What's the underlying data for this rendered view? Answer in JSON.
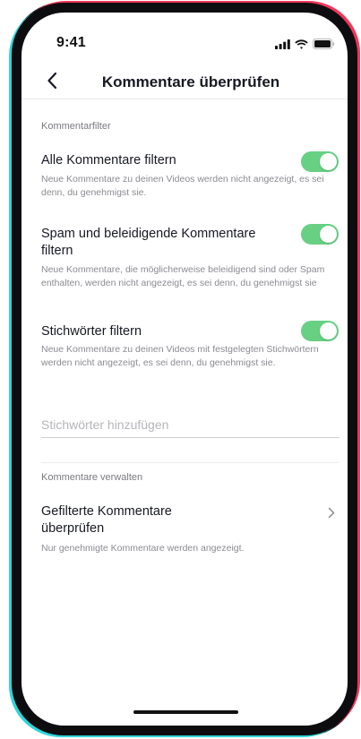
{
  "status_bar": {
    "time": "9:41",
    "icons": [
      "signal-icon",
      "wifi-icon",
      "battery-icon"
    ]
  },
  "header": {
    "back_icon": "chevron-left-icon",
    "title": "Kommentare überprüfen"
  },
  "filter_section": {
    "label": "Kommentarfilter",
    "items": [
      {
        "title": "Alle Kommentare filtern",
        "description": "Neue Kommentare zu deinen Videos werden nicht angezeigt, es sei denn, du genehmigst sie.",
        "enabled": true
      },
      {
        "title": "Spam und beleidigende Kommentare filtern",
        "description": "Neue Kommentare, die möglicherweise beleidigend sind oder Spam enthalten, werden nicht angezeigt, es sei denn, du genehmigst sie",
        "enabled": true
      },
      {
        "title": "Stichwörter filtern",
        "description": "Neue Kommentare zu deinen Videos mit festgelegten Stichwörtern werden nicht angezeigt, es sei denn, du genehmigst sie.",
        "enabled": true
      }
    ],
    "keyword_placeholder": "Stichwörter hinzufügen"
  },
  "manage_section": {
    "label": "Kommentare verwalten",
    "item": {
      "title": "Gefilterte Kommentare überprüfen",
      "description": "Nur genehmigte Kommentare werden angezeigt.",
      "icon": "chevron-right-icon"
    }
  },
  "colors": {
    "toggle_on": "#67d083",
    "text_primary": "#161823",
    "text_secondary": "#8a8b91",
    "phone_edge_cyan": "#2fd5db",
    "phone_edge_pink": "#f1365a"
  }
}
